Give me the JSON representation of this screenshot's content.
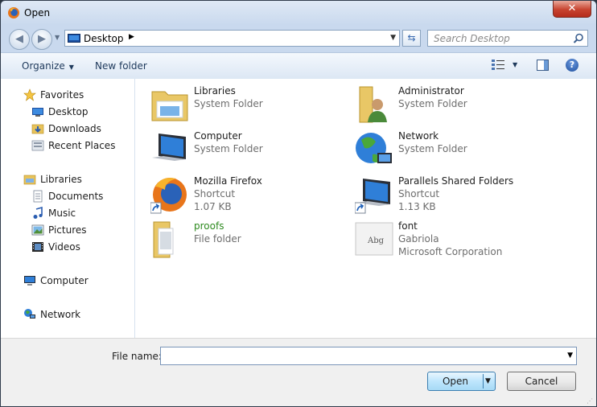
{
  "window": {
    "title": "Open",
    "close_label": "✕"
  },
  "nav": {
    "back_icon": "back-arrow-icon",
    "forward_icon": "forward-arrow-icon",
    "address": "Desktop",
    "search_placeholder": "Search Desktop"
  },
  "toolbar": {
    "organize_label": "Organize",
    "new_folder_label": "New folder",
    "help_label": "?"
  },
  "sidebar": {
    "items": [
      {
        "label": "Favorites",
        "icon": "star-icon"
      },
      {
        "label": "Desktop",
        "icon": "desktop-icon"
      },
      {
        "label": "Downloads",
        "icon": "downloads-folder-icon"
      },
      {
        "label": "Recent Places",
        "icon": "recent-places-icon"
      },
      {
        "label": "Libraries",
        "icon": "libraries-icon"
      },
      {
        "label": "Documents",
        "icon": "documents-icon"
      },
      {
        "label": "Music",
        "icon": "music-icon"
      },
      {
        "label": "Pictures",
        "icon": "pictures-icon"
      },
      {
        "label": "Videos",
        "icon": "videos-icon"
      },
      {
        "label": "Computer",
        "icon": "computer-icon"
      },
      {
        "label": "Network",
        "icon": "network-icon"
      }
    ]
  },
  "files": [
    {
      "name": "Libraries",
      "sub1": "System Folder",
      "sub2": "",
      "icon": "libraries-folder-icon"
    },
    {
      "name": "Administrator",
      "sub1": "System Folder",
      "sub2": "",
      "icon": "user-folder-icon"
    },
    {
      "name": "Computer",
      "sub1": "System Folder",
      "sub2": "",
      "icon": "computer-icon"
    },
    {
      "name": "Network",
      "sub1": "System Folder",
      "sub2": "",
      "icon": "network-globe-icon"
    },
    {
      "name": "Mozilla Firefox",
      "sub1": "Shortcut",
      "sub2": "1.07 KB",
      "icon": "firefox-icon"
    },
    {
      "name": "Parallels Shared Folders",
      "sub1": "Shortcut",
      "sub2": "1.13 KB",
      "icon": "shortcut-computer-icon"
    },
    {
      "name": "proofs",
      "sub1": "File folder",
      "sub2": "",
      "icon": "folder-icon"
    },
    {
      "name": "font",
      "sub1": "Gabriola",
      "sub2": "Microsoft Corporation",
      "icon": "font-file-icon"
    }
  ],
  "colors": {
    "proofs_name": "#2d8a1f"
  },
  "footer": {
    "file_name_label": "File name:",
    "file_name_value": "",
    "open_label": "Open",
    "cancel_label": "Cancel"
  }
}
